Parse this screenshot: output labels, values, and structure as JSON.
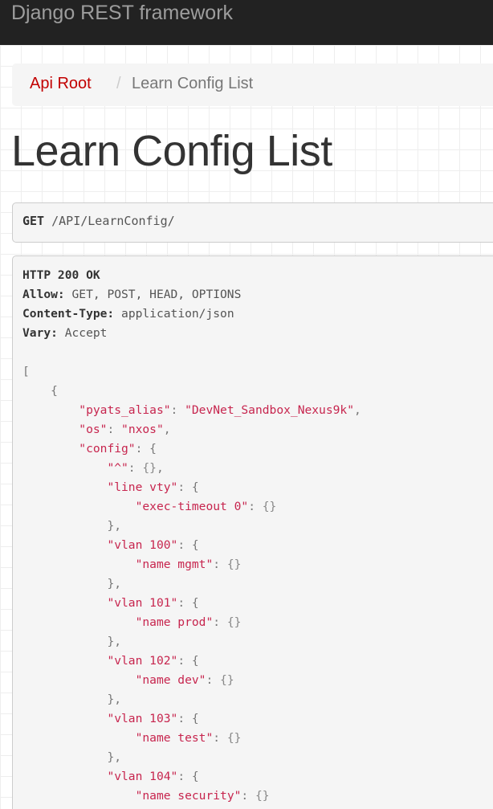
{
  "navbar": {
    "brand": "Django REST framework"
  },
  "breadcrumb": {
    "root_label": "Api Root",
    "separator": "/",
    "current_label": "Learn Config List"
  },
  "page": {
    "title": "Learn Config List"
  },
  "request": {
    "method": "GET",
    "path": "/API/LearnConfig/"
  },
  "response": {
    "status": "HTTP 200 OK",
    "headers": [
      {
        "key": "Allow:",
        "value": "GET, POST, HEAD, OPTIONS"
      },
      {
        "key": "Content-Type:",
        "value": "application/json"
      },
      {
        "key": "Vary:",
        "value": "Accept"
      }
    ],
    "body": {
      "open_array": "[",
      "open_obj": "{",
      "pyats_alias_key": "\"pyats_alias\"",
      "pyats_alias_val": "\"DevNet_Sandbox_Nexus9k\"",
      "os_key": "\"os\"",
      "os_val": "\"nxos\"",
      "config_key": "\"config\"",
      "caret_key": "\"^\"",
      "line_vty_key": "\"line vty\"",
      "exec_timeout_key": "\"exec-timeout 0\"",
      "vlans": [
        {
          "key": "\"vlan 100\"",
          "child": "\"name mgmt\""
        },
        {
          "key": "\"vlan 101\"",
          "child": "\"name prod\""
        },
        {
          "key": "\"vlan 102\"",
          "child": "\"name dev\""
        },
        {
          "key": "\"vlan 103\"",
          "child": "\"name test\""
        },
        {
          "key": "\"vlan 104\"",
          "child": "\"name security\""
        }
      ]
    }
  },
  "colors": {
    "navbar_bg": "#222222",
    "brand_text": "#9d9d9d",
    "link": "#c20000",
    "json_key": "#c7254e"
  }
}
